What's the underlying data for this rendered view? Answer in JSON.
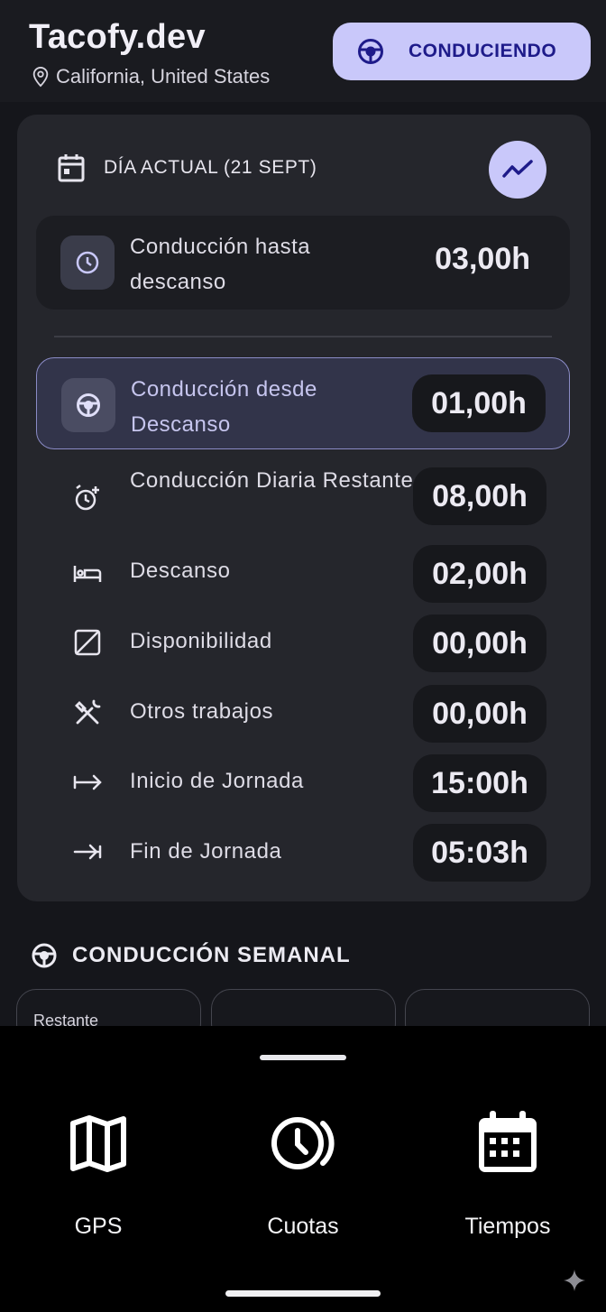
{
  "header": {
    "title": "Tacofy.dev",
    "location": "California, United States",
    "mode_button_label": "CONDUCIENDO"
  },
  "day": {
    "title": "DÍA ACTUAL (21 SEPT)",
    "rows": [
      {
        "label": "Conducción hasta descanso",
        "value": "03,00h",
        "icon": "clock-icon"
      },
      {
        "label": "Conducción desde Descanso",
        "value": "01,00h",
        "icon": "steering-wheel-icon",
        "highlighted": true
      },
      {
        "label": "Conducción Diaria Restante",
        "value": "08,00h",
        "icon": "alarm-add-icon"
      },
      {
        "label": "Descanso",
        "value": "02,00h",
        "icon": "bed-icon"
      },
      {
        "label": "Disponibilidad",
        "value": "00,00h",
        "icon": "availability-icon"
      },
      {
        "label": "Otros trabajos",
        "value": "00,00h",
        "icon": "hammer-wrench-icon"
      },
      {
        "label": "Inicio de Jornada",
        "value": "15:00h",
        "icon": "arrow-right-from-bar-icon"
      },
      {
        "label": "Fin de Jornada",
        "value": "05:03h",
        "icon": "arrow-right-to-bar-icon"
      }
    ]
  },
  "week": {
    "title": "CONDUCCIÓN SEMANAL",
    "cards": [
      "Restante",
      "",
      ""
    ]
  },
  "nav": {
    "items": [
      {
        "label": "GPS",
        "icon": "map-icon"
      },
      {
        "label": "Cuotas",
        "icon": "clock-quota-icon"
      },
      {
        "label": "Tiempos",
        "icon": "calendar-icon"
      }
    ]
  },
  "colors": {
    "accent": "#c9c8fa",
    "accent_text": "#1e1b8a",
    "card": "#25262c",
    "background": "#15161b"
  }
}
